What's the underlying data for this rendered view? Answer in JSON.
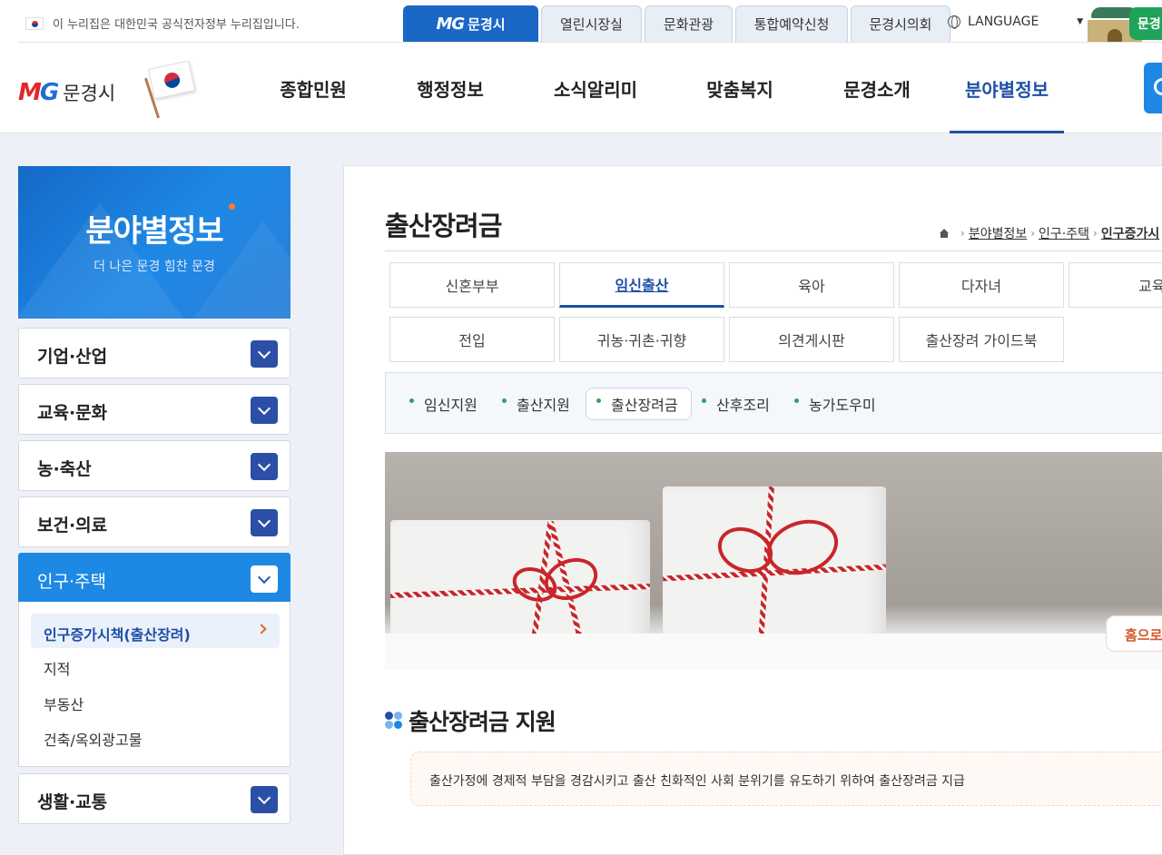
{
  "topbar": {
    "notice": "이 누리집은 대한민국 공식전자정부 누리집입니다.",
    "site_tabs": [
      {
        "mg": "MG",
        "label": "문경시"
      },
      {
        "label": "열린시장실"
      },
      {
        "label": "문화관광"
      },
      {
        "label": "통합예약신청"
      },
      {
        "label": "문경시의회"
      }
    ],
    "language": "LANGUAGE",
    "badge": "문경"
  },
  "header": {
    "logo_mg_m": "M",
    "logo_mg_g": "G",
    "logo_city": "문경시",
    "gnb": [
      "종합민원",
      "행정정보",
      "소식알리미",
      "맞춤복지",
      "문경소개",
      "분야별정보"
    ]
  },
  "sidebar": {
    "title": "분야별정보",
    "subtitle": "더 나은 문경 힘찬 문경",
    "menu": [
      "기업·산업",
      "교육·문화",
      "농·축산",
      "보건·의료",
      "인구·주택",
      "생활·교통"
    ],
    "submenu": [
      "인구증가시책(출산장려)",
      "지적",
      "부동산",
      "건축/옥외광고물"
    ]
  },
  "content": {
    "page_title": "출산장려금",
    "breadcrumb": [
      "분야별정보",
      "인구·주택",
      "인구증가시"
    ],
    "tabs_row1": [
      "신혼부부",
      "임신출산",
      "육아",
      "다자녀",
      "교육"
    ],
    "tabs_row2": [
      "전입",
      "귀농·귀촌·귀향",
      "의견게시판",
      "출산장려 가이드북"
    ],
    "subnav": [
      "임신지원",
      "출산지원",
      "출산장려금",
      "산후조리",
      "농가도우미"
    ],
    "home_badge": "홈으로",
    "section_title": "출산장려금 지원",
    "notice": "출산가정에 경제적 부담을 경감시키고 출산 친화적인 사회 분위기를 유도하기 위하여 출산장려금 지급"
  },
  "colors": {
    "primary": "#1e88e5",
    "navy": "#1d4fa5",
    "toggle": "#2b4fa6",
    "accent_orange": "#e8642a",
    "bullet_green": "#2aa36a"
  }
}
